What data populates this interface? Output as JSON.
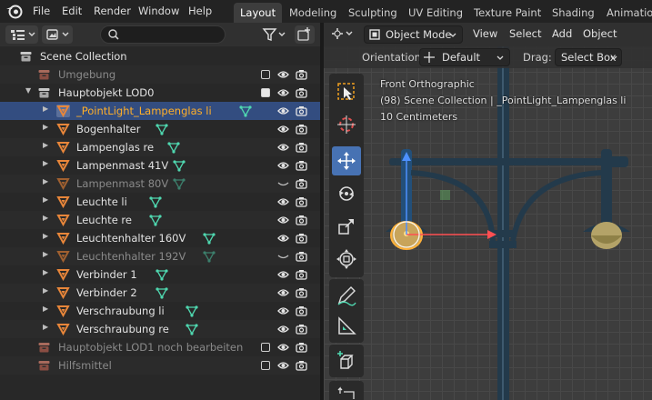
{
  "menu": {
    "items": [
      "File",
      "Edit",
      "Render",
      "Window",
      "Help"
    ]
  },
  "workspace_tabs": [
    "Layout",
    "Modeling",
    "Sculpting",
    "UV Editing",
    "Texture Paint",
    "Shading",
    "Animation"
  ],
  "active_tab": "Layout",
  "outliner": {
    "search_value": "",
    "rows": [
      {
        "label": "Scene Collection",
        "type": "scene",
        "indent": 0
      },
      {
        "label": "Umgebung",
        "type": "collection",
        "indent": 1,
        "dim": true,
        "checkbox": "off",
        "eye": "open"
      },
      {
        "label": "Hauptobjekt LOD0",
        "type": "collection",
        "indent": 1,
        "expanded": true,
        "checkbox": "on",
        "eye": "open"
      },
      {
        "label": "_PointLight_Lampenglas li",
        "type": "object",
        "indent": 2,
        "selected": true,
        "highlight": true,
        "eye": "open"
      },
      {
        "label": "Bogenhalter",
        "type": "object",
        "indent": 2,
        "eye": "open"
      },
      {
        "label": "Lampenglas re",
        "type": "object",
        "indent": 2,
        "eye": "open"
      },
      {
        "label": "Lampenmast 41V",
        "type": "object",
        "indent": 2,
        "eye": "open"
      },
      {
        "label": "Lampenmast 80V",
        "type": "object",
        "indent": 2,
        "dim": true,
        "eye": "closed"
      },
      {
        "label": "Leuchte li",
        "type": "object",
        "indent": 2,
        "eye": "open"
      },
      {
        "label": "Leuchte re",
        "type": "object",
        "indent": 2,
        "eye": "open"
      },
      {
        "label": "Leuchtenhalter 160V",
        "type": "object",
        "indent": 2,
        "eye": "open"
      },
      {
        "label": "Leuchtenhalter 192V",
        "type": "object",
        "indent": 2,
        "dim": true,
        "eye": "closed"
      },
      {
        "label": "Verbinder 1",
        "type": "object",
        "indent": 2,
        "eye": "open"
      },
      {
        "label": "Verbinder 2",
        "type": "object",
        "indent": 2,
        "eye": "open"
      },
      {
        "label": "Verschraubung li",
        "type": "object",
        "indent": 2,
        "eye": "open"
      },
      {
        "label": "Verschraubung re",
        "type": "object",
        "indent": 2,
        "eye": "open"
      },
      {
        "label": "Hauptobjekt LOD1 noch bearbeiten",
        "type": "collection",
        "indent": 1,
        "dim": true,
        "checkbox": "off",
        "eye": "open"
      },
      {
        "label": "Hilfsmittel",
        "type": "collection",
        "indent": 1,
        "dim": true,
        "checkbox": "off",
        "eye": "open"
      }
    ]
  },
  "viewport": {
    "header": {
      "mode": "Object Mode",
      "menus": [
        "View",
        "Select",
        "Add",
        "Object"
      ]
    },
    "sub_header": {
      "orientation_label": "Orientation:",
      "orientation_value": "Default",
      "drag_label": "Drag:",
      "drag_value": "Select Box"
    },
    "overlay": {
      "view_name": "Front Orthographic",
      "collection_info": "(98) Scene Collection | _PointLight_Lampenglas li",
      "scale": "10 Centimeters"
    },
    "tools": [
      "select-box",
      "cursor",
      "move",
      "rotate",
      "scale",
      "transform",
      "annotate",
      "measure",
      "add-cube",
      "extra"
    ],
    "active_tool": "move"
  },
  "colors": {
    "selection_row": "#334d80",
    "active_tool": "#4772b3",
    "object_orange": "#e8863a",
    "mesh_green": "#4fd8b0",
    "highlight_text": "#ffaf29",
    "lamp_pole": "#233a4b"
  }
}
